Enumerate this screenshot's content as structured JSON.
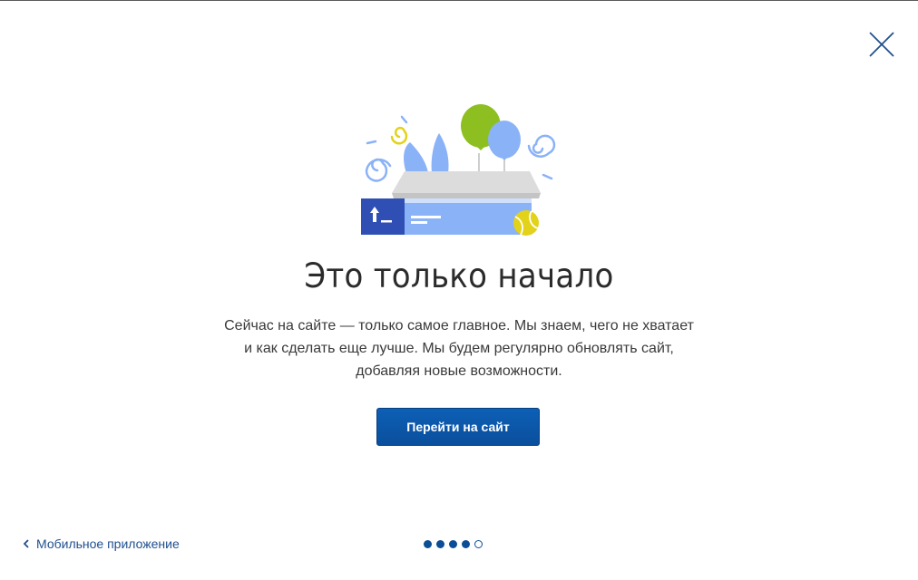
{
  "dialog": {
    "headline": "Это только начало",
    "description": "Сейчас на сайте — только самое главное. Мы знаем, чего не хватает и как сделать еще лучше. Мы будем регулярно обновлять сайт, добавляя новые возможности.",
    "cta_label": "Перейти на сайт",
    "back_link_label": "Мобильное приложение",
    "close_icon": "close-icon",
    "pagination": {
      "total": 5,
      "current": 5
    }
  },
  "colors": {
    "primary": "#0b4d96",
    "button": "#0d5fb6",
    "link": "#1f4f8f",
    "illustration_blue": "#8ab2f7",
    "illustration_dark": "#2f4fb5",
    "balloon_green": "#8cbf1f",
    "ball_yellow": "#e3d21a"
  }
}
